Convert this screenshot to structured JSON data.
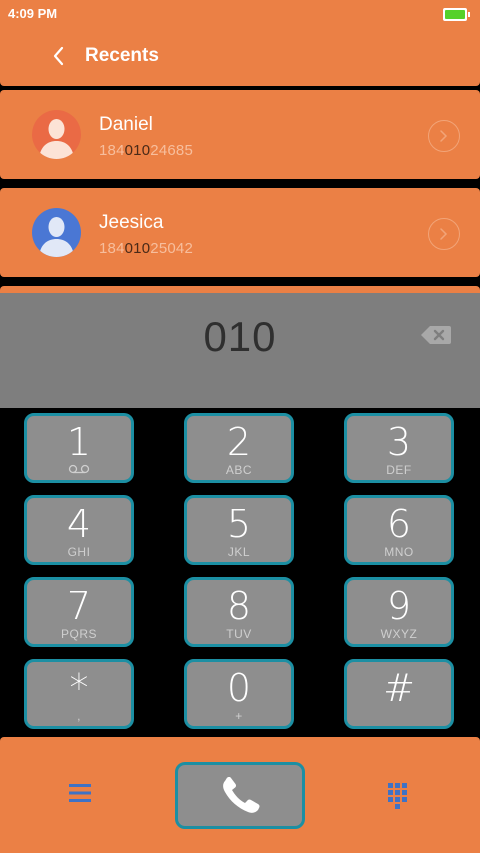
{
  "status_bar": {
    "time": "4:09 PM",
    "battery_icon": "battery-icon",
    "battery_color": "#55D12A"
  },
  "header": {
    "title": "Recents",
    "back_icon": "chevron-left-icon"
  },
  "recents": [
    {
      "name": "Daniel",
      "number_prefix": "184",
      "number_match": "010",
      "number_suffix": "24685",
      "avatar_color": "#EA6A45"
    },
    {
      "name": "Jeesica",
      "number_prefix": "184",
      "number_match": "010",
      "number_suffix": "25042",
      "avatar_color": "#4A77D4"
    }
  ],
  "dialer": {
    "number": "010",
    "backspace_icon": "backspace-icon"
  },
  "keypad": {
    "k1": {
      "digit": "1",
      "letters": "ꝎꝎ"
    },
    "k2": {
      "digit": "2",
      "letters": "ABC"
    },
    "k3": {
      "digit": "3",
      "letters": "DEF"
    },
    "k4": {
      "digit": "4",
      "letters": "GHI"
    },
    "k5": {
      "digit": "5",
      "letters": "JKL"
    },
    "k6": {
      "digit": "6",
      "letters": "MNO"
    },
    "k7": {
      "digit": "7",
      "letters": "PQRS"
    },
    "k8": {
      "digit": "8",
      "letters": "TUV"
    },
    "k9": {
      "digit": "9",
      "letters": "WXYZ"
    },
    "kstar": {
      "digit": "*",
      "letters": ","
    },
    "k0": {
      "digit": "0",
      "letters": "+"
    },
    "khash": {
      "digit": "#",
      "letters": ""
    }
  },
  "bottom_bar": {
    "menu_icon": "menu-icon",
    "call_icon": "phone-icon",
    "dialpad_icon": "dialpad-icon"
  },
  "colors": {
    "accent": "#EB8045",
    "key_border": "#1C8FA3",
    "key_fill": "#8E8E8E",
    "icon_blue": "#3F72C5"
  }
}
